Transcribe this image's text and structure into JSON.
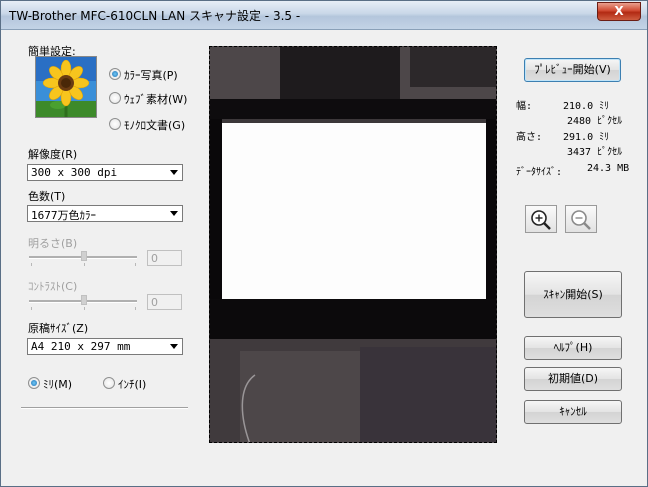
{
  "window": {
    "title": "TW-Brother MFC-610CLN LAN スキャナ設定 - 3.5 -",
    "close_label": "X"
  },
  "left": {
    "easy_settings_label": "簡単設定:",
    "modes": [
      {
        "label": "ｶﾗｰ写真(P)",
        "selected": true
      },
      {
        "label": "ｳｪﾌﾞ素材(W)",
        "selected": false
      },
      {
        "label": "ﾓﾉｸﾛ文書(G)",
        "selected": false
      }
    ],
    "resolution_label": "解像度(R)",
    "resolution_value": "300 x 300 dpi",
    "colors_label": "色数(T)",
    "colors_value": "1677万色ｶﾗｰ",
    "brightness_label": "明るさ(B)",
    "brightness_value": "0",
    "contrast_label": "ｺﾝﾄﾗｽﾄ(C)",
    "contrast_value": "0",
    "doc_size_label": "原稿ｻｲｽﾞ(Z)",
    "doc_size_value": "A4 210 x 297 mm",
    "units": [
      {
        "label": "ﾐﾘ(M)",
        "selected": true
      },
      {
        "label": "ｲﾝﾁ(I)",
        "selected": false
      }
    ]
  },
  "right": {
    "preview_button": "ﾌﾟﾚﾋﾞｭｰ開始(V)",
    "width_label": "幅:",
    "width_mm": "210.0 ﾐﾘ",
    "width_px": "2480 ﾋﾟｸｾﾙ",
    "height_label": "高さ:",
    "height_mm": "291.0 ﾐﾘ",
    "height_px": "3437 ﾋﾟｸｾﾙ",
    "data_size_label": "ﾃﾞｰﾀｻｲｽﾞ:",
    "data_size_value": "24.3 MB",
    "scan_button": "ｽｷｬﾝ開始(S)",
    "help_button": "ﾍﾙﾌﾟ(H)",
    "defaults_button": "初期値(D)",
    "cancel_button": "ｷｬﾝｾﾙ"
  },
  "icons": {
    "zoom_in": "zoom-in-icon",
    "zoom_out": "zoom-out-icon",
    "sunflower": "sunflower-photo-icon"
  }
}
